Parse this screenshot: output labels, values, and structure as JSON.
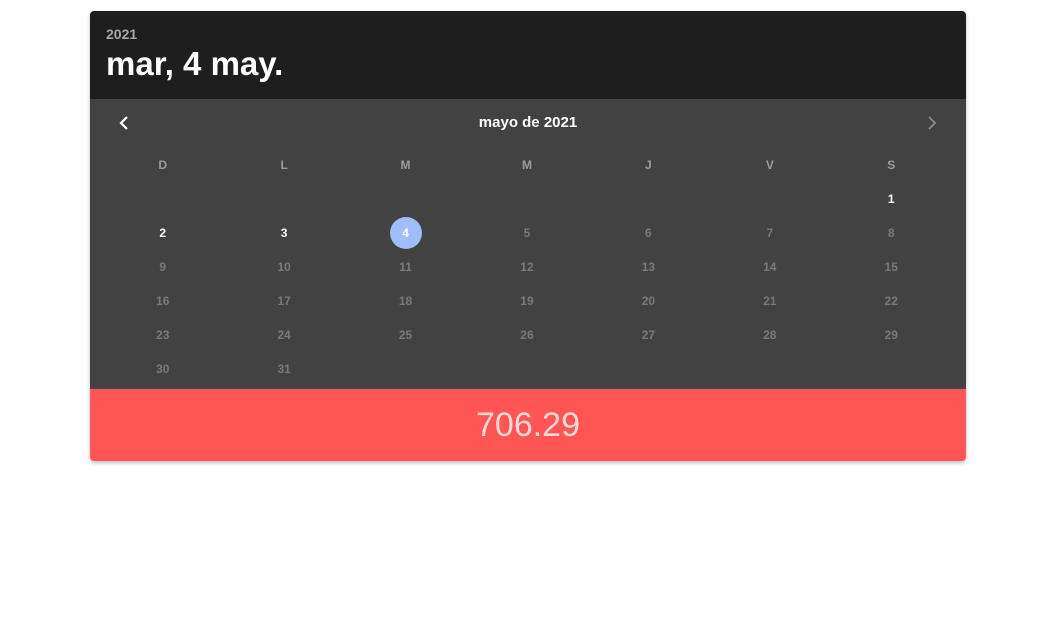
{
  "header": {
    "year": "2021",
    "date": "mar, 4 may."
  },
  "calendar": {
    "month_label": "mayo de 2021",
    "prev_icon": "chevron-left-icon",
    "next_icon": "chevron-right-icon",
    "weekdays": [
      "D",
      "L",
      "M",
      "M",
      "J",
      "V",
      "S"
    ],
    "weeks": [
      [
        {
          "label": "",
          "state": "empty"
        },
        {
          "label": "",
          "state": "empty"
        },
        {
          "label": "",
          "state": "empty"
        },
        {
          "label": "",
          "state": "empty"
        },
        {
          "label": "",
          "state": "empty"
        },
        {
          "label": "",
          "state": "empty"
        },
        {
          "label": "1",
          "state": "enabled"
        }
      ],
      [
        {
          "label": "2",
          "state": "enabled"
        },
        {
          "label": "3",
          "state": "enabled"
        },
        {
          "label": "4",
          "state": "selected"
        },
        {
          "label": "5",
          "state": "disabled"
        },
        {
          "label": "6",
          "state": "disabled"
        },
        {
          "label": "7",
          "state": "disabled"
        },
        {
          "label": "8",
          "state": "disabled"
        }
      ],
      [
        {
          "label": "9",
          "state": "disabled"
        },
        {
          "label": "10",
          "state": "disabled"
        },
        {
          "label": "11",
          "state": "disabled"
        },
        {
          "label": "12",
          "state": "disabled"
        },
        {
          "label": "13",
          "state": "disabled"
        },
        {
          "label": "14",
          "state": "disabled"
        },
        {
          "label": "15",
          "state": "disabled"
        }
      ],
      [
        {
          "label": "16",
          "state": "disabled"
        },
        {
          "label": "17",
          "state": "disabled"
        },
        {
          "label": "18",
          "state": "disabled"
        },
        {
          "label": "19",
          "state": "disabled"
        },
        {
          "label": "20",
          "state": "disabled"
        },
        {
          "label": "21",
          "state": "disabled"
        },
        {
          "label": "22",
          "state": "disabled"
        }
      ],
      [
        {
          "label": "23",
          "state": "disabled"
        },
        {
          "label": "24",
          "state": "disabled"
        },
        {
          "label": "25",
          "state": "disabled"
        },
        {
          "label": "26",
          "state": "disabled"
        },
        {
          "label": "27",
          "state": "disabled"
        },
        {
          "label": "28",
          "state": "disabled"
        },
        {
          "label": "29",
          "state": "disabled"
        }
      ],
      [
        {
          "label": "30",
          "state": "disabled"
        },
        {
          "label": "31",
          "state": "disabled"
        },
        {
          "label": "",
          "state": "empty"
        },
        {
          "label": "",
          "state": "empty"
        },
        {
          "label": "",
          "state": "empty"
        },
        {
          "label": "",
          "state": "empty"
        },
        {
          "label": "",
          "state": "empty"
        }
      ]
    ]
  },
  "footer": {
    "value": "706.29"
  },
  "colors": {
    "header_bg": "#1e1e1e",
    "calendar_bg": "#424242",
    "selected_day": "#9fbdfa",
    "footer_bg": "#ff5555"
  }
}
